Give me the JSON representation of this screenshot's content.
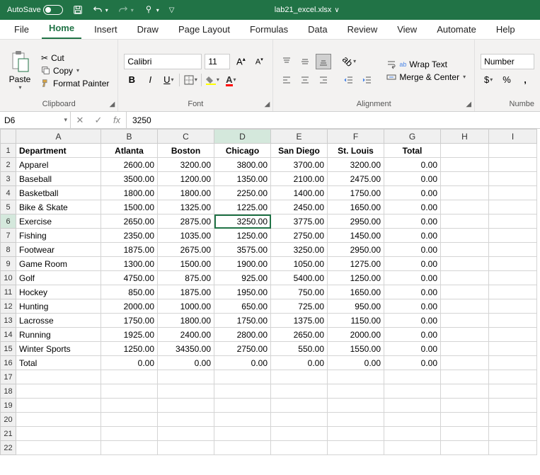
{
  "titlebar": {
    "autosave_label": "AutoSave",
    "filename": "lab21_excel.xlsx"
  },
  "menu": {
    "tabs": [
      "File",
      "Home",
      "Insert",
      "Draw",
      "Page Layout",
      "Formulas",
      "Data",
      "Review",
      "View",
      "Automate",
      "Help"
    ],
    "active": "Home"
  },
  "ribbon": {
    "clipboard": {
      "paste": "Paste",
      "cut": "Cut",
      "copy": "Copy",
      "format_painter": "Format Painter",
      "label": "Clipboard"
    },
    "font": {
      "name": "Calibri",
      "size": "11",
      "label": "Font"
    },
    "alignment": {
      "wrap": "Wrap Text",
      "merge": "Merge & Center",
      "label": "Alignment"
    },
    "number": {
      "format": "Number",
      "label": "Numbe"
    }
  },
  "formula_bar": {
    "cell_ref": "D6",
    "value": "3250"
  },
  "selected": {
    "row": 6,
    "col": "D"
  },
  "columns": [
    "A",
    "B",
    "C",
    "D",
    "E",
    "F",
    "G",
    "H",
    "I"
  ],
  "headers": [
    "Department",
    "Atlanta",
    "Boston",
    "Chicago",
    "San Diego",
    "St. Louis",
    "Total"
  ],
  "rows": [
    {
      "dept": "Apparel",
      "vals": [
        "2600.00",
        "3200.00",
        "3800.00",
        "3700.00",
        "3200.00",
        "0.00"
      ]
    },
    {
      "dept": "Baseball",
      "vals": [
        "3500.00",
        "1200.00",
        "1350.00",
        "2100.00",
        "2475.00",
        "0.00"
      ]
    },
    {
      "dept": "Basketball",
      "vals": [
        "1800.00",
        "1800.00",
        "2250.00",
        "1400.00",
        "1750.00",
        "0.00"
      ]
    },
    {
      "dept": "Bike & Skate",
      "vals": [
        "1500.00",
        "1325.00",
        "1225.00",
        "2450.00",
        "1650.00",
        "0.00"
      ]
    },
    {
      "dept": "Exercise",
      "vals": [
        "2650.00",
        "2875.00",
        "3250.00",
        "3775.00",
        "2950.00",
        "0.00"
      ]
    },
    {
      "dept": "Fishing",
      "vals": [
        "2350.00",
        "1035.00",
        "1250.00",
        "2750.00",
        "1450.00",
        "0.00"
      ]
    },
    {
      "dept": "Footwear",
      "vals": [
        "1875.00",
        "2675.00",
        "3575.00",
        "3250.00",
        "2950.00",
        "0.00"
      ]
    },
    {
      "dept": "Game Room",
      "vals": [
        "1300.00",
        "1500.00",
        "1900.00",
        "1050.00",
        "1275.00",
        "0.00"
      ]
    },
    {
      "dept": "Golf",
      "vals": [
        "4750.00",
        "875.00",
        "925.00",
        "5400.00",
        "1250.00",
        "0.00"
      ]
    },
    {
      "dept": "Hockey",
      "vals": [
        "850.00",
        "1875.00",
        "1950.00",
        "750.00",
        "1650.00",
        "0.00"
      ]
    },
    {
      "dept": "Hunting",
      "vals": [
        "2000.00",
        "1000.00",
        "650.00",
        "725.00",
        "950.00",
        "0.00"
      ]
    },
    {
      "dept": "Lacrosse",
      "vals": [
        "1750.00",
        "1800.00",
        "1750.00",
        "1375.00",
        "1150.00",
        "0.00"
      ]
    },
    {
      "dept": "Running",
      "vals": [
        "1925.00",
        "2400.00",
        "2800.00",
        "2650.00",
        "2000.00",
        "0.00"
      ]
    },
    {
      "dept": "Winter Sports",
      "vals": [
        "1250.00",
        "34350.00",
        "2750.00",
        "550.00",
        "1550.00",
        "0.00"
      ]
    },
    {
      "dept": "Total",
      "vals": [
        "0.00",
        "0.00",
        "0.00",
        "0.00",
        "0.00",
        "0.00"
      ]
    }
  ],
  "empty_rows": 6
}
